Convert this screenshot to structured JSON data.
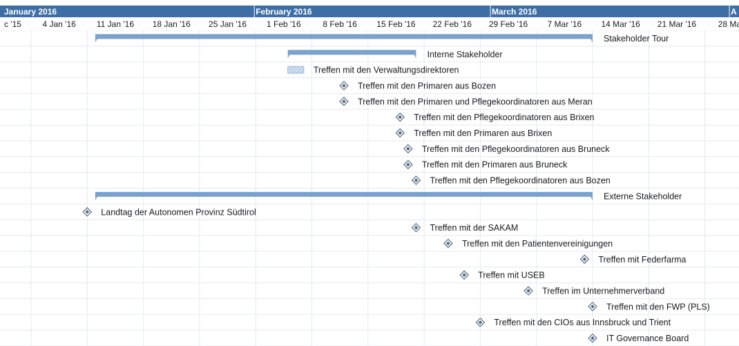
{
  "chart_data": {
    "type": "gantt",
    "timeline": {
      "months": [
        "January 2016",
        "February 2016",
        "March 2016",
        "A"
      ],
      "weeks": [
        "c '15",
        "4 Jan '16",
        "11 Jan '16",
        "18 Jan '16",
        "25 Jan '16",
        "1 Feb '16",
        "8 Feb '16",
        "15 Feb '16",
        "22 Feb '16",
        "29 Feb '16",
        "7 Mar '16",
        "14 Mar '16",
        "21 Mar '16",
        "28 Mar '"
      ]
    },
    "colors": {
      "header": "#3d6ea5",
      "summary": "#7aa2cf",
      "milestone": "#5a6f88",
      "task_fill": "#b9cfe6",
      "grid": "#e4eaf1"
    },
    "tasks": [
      {
        "name": "Stakeholder Tour",
        "kind": "summary",
        "start": "2016-01-12",
        "end": "2016-03-14"
      },
      {
        "name": "Interne Stakeholder",
        "kind": "summary",
        "start": "2016-02-05",
        "end": "2016-02-21"
      },
      {
        "name": "Treffen mit den Verwaltungsdirektoren",
        "kind": "task",
        "start": "2016-02-05",
        "end": "2016-02-07"
      },
      {
        "name": "Treffen mit den Primaren aus Bozen",
        "kind": "milestone",
        "date": "2016-02-12"
      },
      {
        "name": "Treffen mit den Primaren und Pflegekoordinatoren aus Meran",
        "kind": "milestone",
        "date": "2016-02-12"
      },
      {
        "name": "Treffen mit den Pflegekoordinatoren aus Brixen",
        "kind": "milestone",
        "date": "2016-02-19"
      },
      {
        "name": "Treffen mit den Primaren aus Brixen",
        "kind": "milestone",
        "date": "2016-02-19"
      },
      {
        "name": "Treffen mit den Pflegekoordinatoren aus Bruneck",
        "kind": "milestone",
        "date": "2016-02-20"
      },
      {
        "name": "Treffen mit den Primaren aus Bruneck",
        "kind": "milestone",
        "date": "2016-02-20"
      },
      {
        "name": "Treffen mit den Pflegekoordinatoren aus Bozen",
        "kind": "milestone",
        "date": "2016-02-21"
      },
      {
        "name": "Externe Stakeholder",
        "kind": "summary",
        "start": "2016-01-12",
        "end": "2016-03-14"
      },
      {
        "name": "Landtag der Autonomen Provinz Südtirol",
        "kind": "milestone",
        "date": "2016-01-11"
      },
      {
        "name": "Treffen mit der SAKAM",
        "kind": "milestone",
        "date": "2016-02-21"
      },
      {
        "name": "Treffen mit den Patientenvereinigungen",
        "kind": "milestone",
        "date": "2016-02-25"
      },
      {
        "name": "Treffen mit Federfarma",
        "kind": "milestone",
        "date": "2016-03-13"
      },
      {
        "name": "Treffen mit USEB",
        "kind": "milestone",
        "date": "2016-02-27"
      },
      {
        "name": "Treffen im Unternehmerverband",
        "kind": "milestone",
        "date": "2016-03-06"
      },
      {
        "name": "Treffen mit den FWP (PLS)",
        "kind": "milestone",
        "date": "2016-03-14"
      },
      {
        "name": "Treffen mit den CIOs aus Innsbruck und Trient",
        "kind": "milestone",
        "date": "2016-02-29"
      },
      {
        "name": "IT Governance Board",
        "kind": "milestone",
        "date": "2016-03-14"
      }
    ]
  }
}
